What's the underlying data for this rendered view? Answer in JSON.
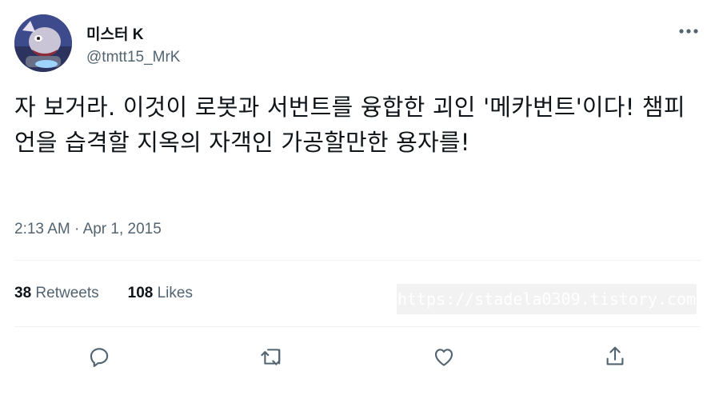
{
  "author": {
    "name": "미스터 K",
    "handle": "@tmtt15_MrK"
  },
  "tweet": {
    "text": "자 보거라. 이것이 로봇과 서번트를 융합한 괴인 '메카번트'이다! 챔피언을 습격할 지옥의 자객인 가공할만한 용자를!",
    "time": "2:13 AM",
    "separator": "·",
    "date": "Apr 1, 2015"
  },
  "stats": {
    "retweets_count": "38",
    "retweets_label": "Retweets",
    "likes_count": "108",
    "likes_label": "Likes"
  },
  "watermark": "https://stadela0309.tistory.com",
  "icons": {
    "more": "more-dots-icon",
    "reply": "reply-icon",
    "retweet": "retweet-icon",
    "like": "like-icon",
    "share": "share-icon"
  },
  "colors": {
    "text": "#0f1419",
    "secondary": "#536471",
    "divider": "#eff3f4"
  }
}
